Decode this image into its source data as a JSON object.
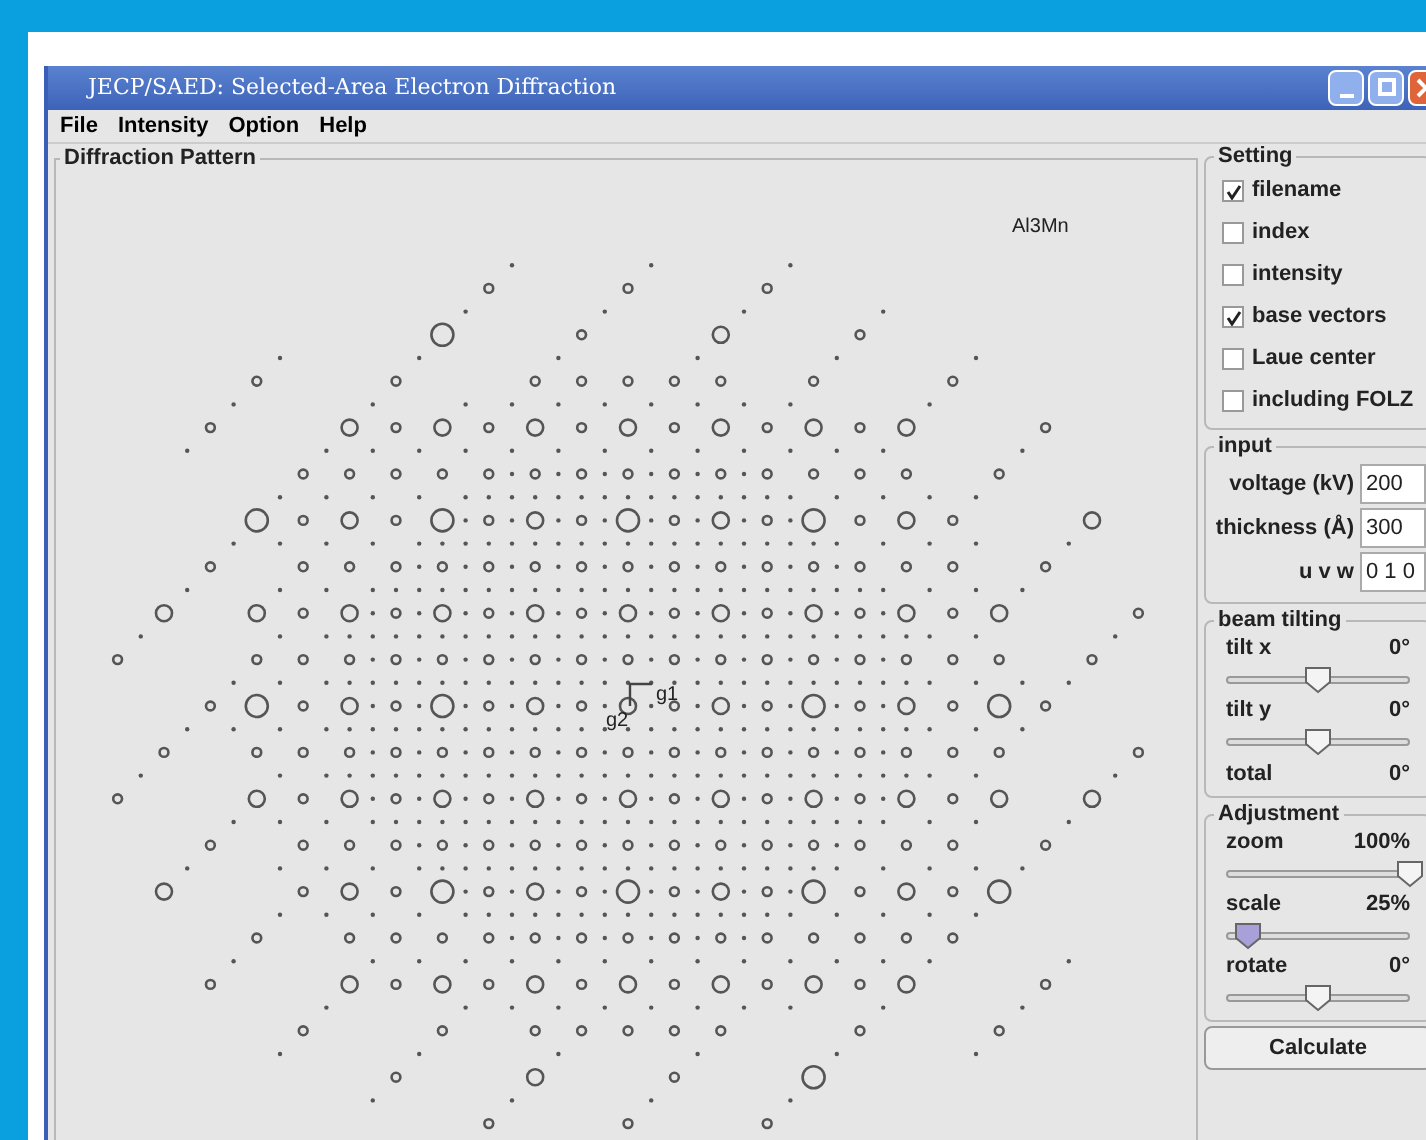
{
  "window": {
    "title": "JECP/SAED: Selected-Area Electron Diffraction"
  },
  "menu": [
    "File",
    "Intensity",
    "Option",
    "Help"
  ],
  "pattern": {
    "title": "Diffraction Pattern",
    "filename": "Al3Mn",
    "vector_labels": [
      "g1",
      "g2"
    ]
  },
  "setting": {
    "title": "Setting",
    "options": [
      {
        "label": "filename",
        "checked": true
      },
      {
        "label": "index",
        "checked": false
      },
      {
        "label": "intensity",
        "checked": false
      },
      {
        "label": "base vectors",
        "checked": true
      },
      {
        "label": "Laue center",
        "checked": false
      },
      {
        "label": "including FOLZ",
        "checked": false
      }
    ]
  },
  "input": {
    "title": "input",
    "fields": [
      {
        "label": "voltage (kV)",
        "value": "200"
      },
      {
        "label": "thickness (Å)",
        "value": "300"
      },
      {
        "label": "u v w",
        "value": "0 1 0"
      }
    ]
  },
  "beam_tilting": {
    "title": "beam tilting",
    "sliders": [
      {
        "label": "tilt x",
        "reading": "0°",
        "level": 0.5,
        "focused": false
      },
      {
        "label": "tilt y",
        "reading": "0°",
        "level": 0.5,
        "focused": false
      }
    ],
    "total": {
      "label": "total",
      "reading": "0°"
    }
  },
  "adjustment": {
    "title": "Adjustment",
    "sliders": [
      {
        "label": "zoom",
        "reading": "100%",
        "level": 1,
        "focused": false
      },
      {
        "label": "scale",
        "reading": "25%",
        "level": 0.12,
        "focused": true
      },
      {
        "label": "rotate",
        "reading": "0°",
        "level": 0.5,
        "focused": false
      }
    ]
  },
  "calculate_button": "Calculate"
}
